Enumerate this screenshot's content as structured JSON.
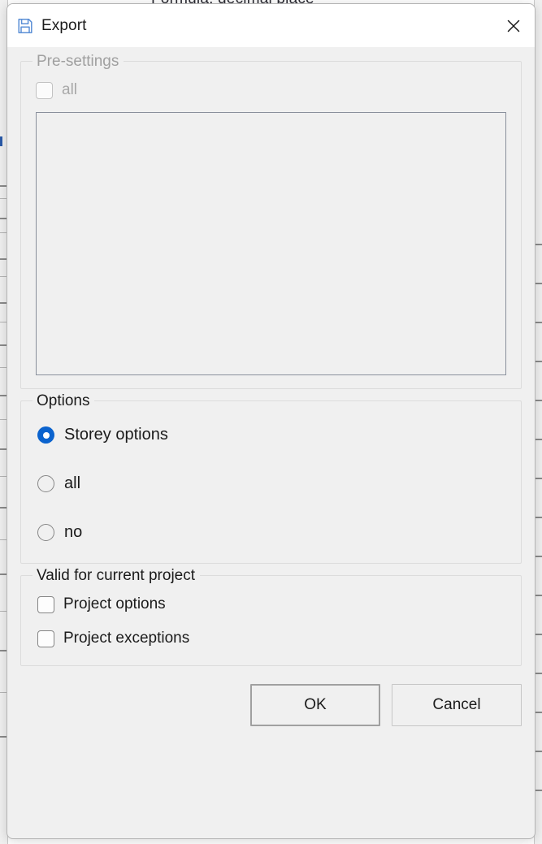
{
  "backdrop": {
    "obscured_title": "Formula: decimal place"
  },
  "dialog": {
    "title": "Export",
    "title_icon": "save-floppy-icon",
    "close_icon": "close-icon",
    "accent_color": "#0b63ce",
    "groups": {
      "presettings": {
        "legend": "Pre-settings",
        "enabled": false,
        "checkbox": {
          "label": "all",
          "checked": false,
          "enabled": false
        },
        "list_items": []
      },
      "options": {
        "legend": "Options",
        "enabled": true,
        "radios": [
          {
            "label": "Storey options",
            "selected": true
          },
          {
            "label": "all",
            "selected": false
          },
          {
            "label": "no",
            "selected": false
          }
        ]
      },
      "valid_for_project": {
        "legend": "Valid for current project",
        "enabled": true,
        "checkboxes": [
          {
            "label": "Project options",
            "checked": false
          },
          {
            "label": "Project exceptions",
            "checked": false
          }
        ]
      }
    },
    "buttons": {
      "ok": "OK",
      "cancel": "Cancel"
    }
  }
}
